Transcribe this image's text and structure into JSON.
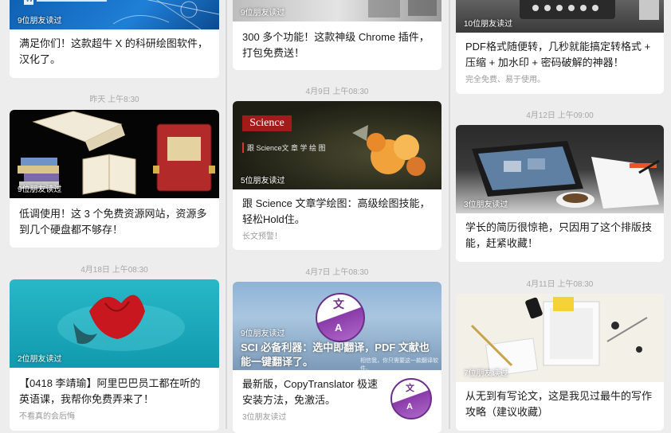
{
  "columns": [
    {
      "cards": [
        {
          "readers": "9位朋友读过",
          "title": "满足你们！这款超牛 X 的科研绘图软件，汉化了。",
          "subtitle": ""
        },
        {
          "readers": "9位朋友读过",
          "title": "低调使用！这 3 个免费资源网站，资源多到几个硬盘都不够存！",
          "subtitle": ""
        },
        {
          "readers": "2位朋友读过",
          "title": "【0418 李靖瑜】阿里巴巴员工都在听的英语课，我帮你免费弄来了！",
          "subtitle": "不看真的会后悔"
        }
      ],
      "dates": [
        "昨天 上午8:30",
        "4月18日 上午08:30"
      ]
    },
    {
      "cards": [
        {
          "readers": "9位朋友读过",
          "title": "300 多个功能！这款神级 Chrome 插件，打包免费送！",
          "subtitle": ""
        },
        {
          "readers": "5位朋友读过",
          "title": "跟 Science 文章学绘图：高级绘图技能，轻松Hold住。",
          "subtitle": "长文预警！",
          "logo": "Science",
          "banner": "跟 Science文 章 学 绘 图"
        },
        {
          "readers": "9位朋友读过",
          "title": "最新版，CopyTranslator 极速安装方法，免激活。",
          "subtitle": "3位朋友读过",
          "overlay": "SCI 必备利器：选中即翻译，PDF 文献也能一键翻译了。",
          "overlay_small": "相信我，你只需要这一款翻译软件。",
          "app_glyph_top": "文",
          "app_glyph_bottom": "A"
        }
      ],
      "dates": [
        "4月9日 上午08:30",
        "4月7日 上午08:30"
      ]
    },
    {
      "cards": [
        {
          "readers": "10位朋友读过",
          "title": "PDF格式随便转，几秒就能搞定转格式 + 压缩 + 加水印 + 密码破解的神器！",
          "subtitle": "完全免费、易于使用。"
        },
        {
          "readers": "3位朋友读过",
          "title": "学长的简历很惊艳，只因用了这个排版技能，赶紧收藏！",
          "subtitle": ""
        },
        {
          "readers": "7位朋友读过",
          "title": "从无到有写论文，这是我见过最牛的写作攻略（建议收藏）",
          "subtitle": ""
        }
      ],
      "dates": [
        "4月12日 上午09:00",
        "4月11日 上午08:30"
      ]
    }
  ]
}
